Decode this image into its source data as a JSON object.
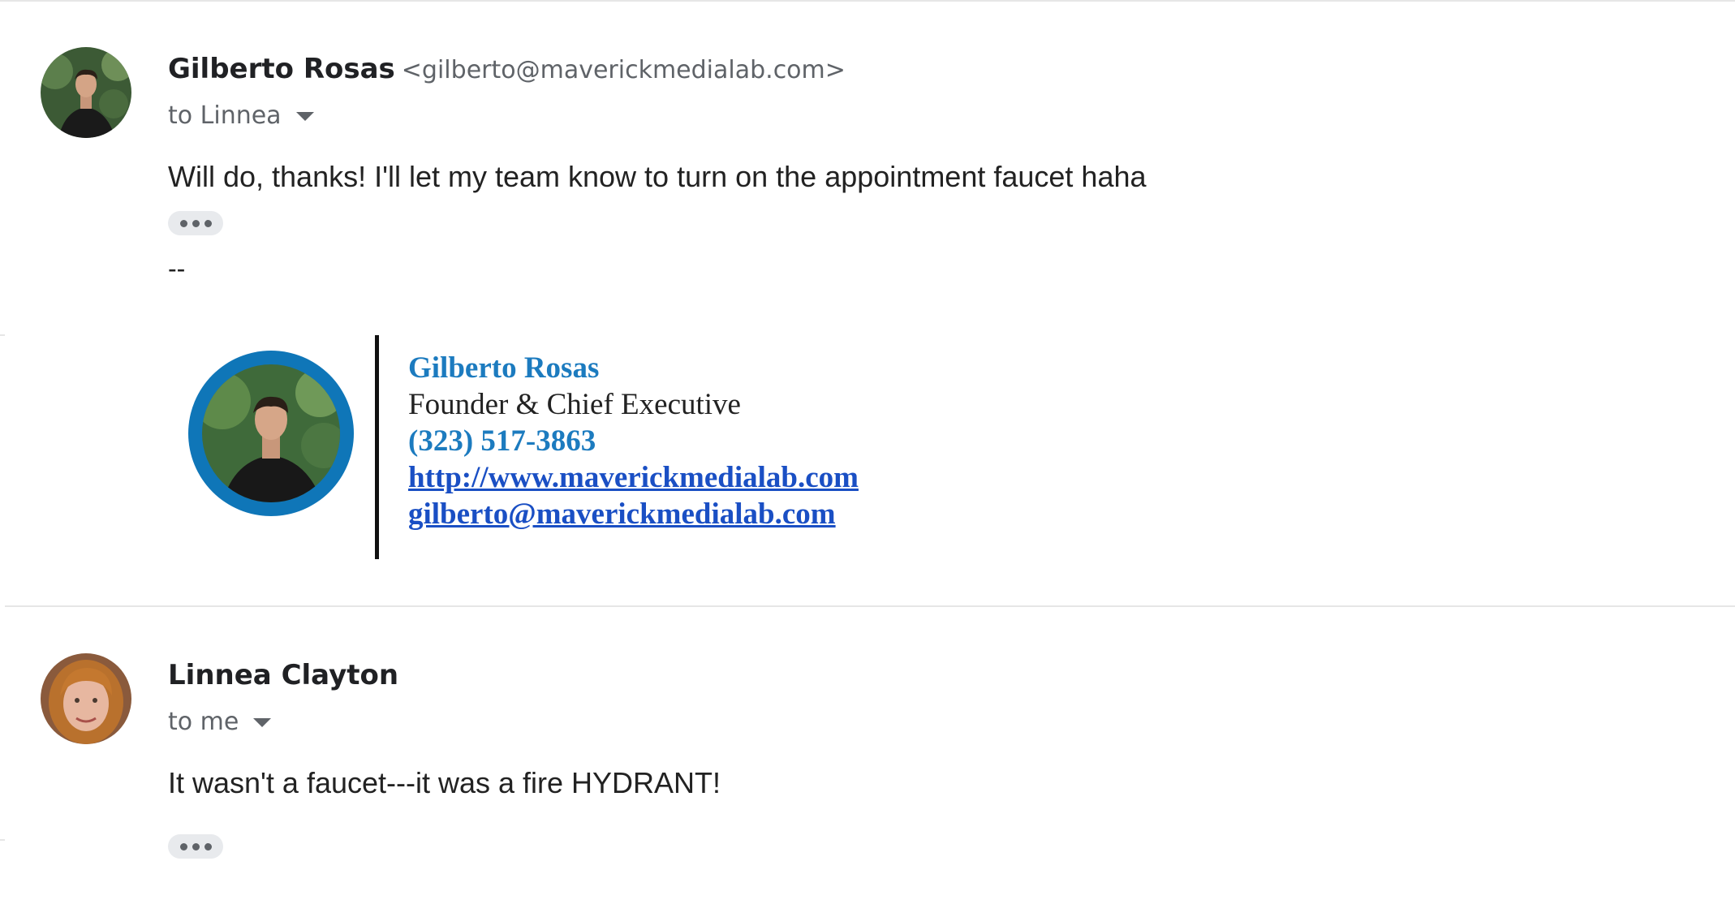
{
  "messages": [
    {
      "sender_name": "Gilberto Rosas",
      "sender_email": "<gilberto@maverickmedialab.com>",
      "recipient": "to Linnea",
      "body": "Will do, thanks! I'll let my team know to turn on the appointment faucet haha",
      "signature_separator": "--",
      "signature": {
        "name": "Gilberto Rosas",
        "title": "Founder & Chief Executive",
        "phone": "(323) 517-3863",
        "website": "http://www.maverickmedialab.com",
        "email": "gilberto@maverickmedialab.com"
      }
    },
    {
      "sender_name": "Linnea Clayton",
      "recipient": "to me",
      "body": "It wasn't a faucet---it was a fire HYDRANT!"
    }
  ],
  "icons": {
    "recipient_toggle": "caret-down-icon",
    "show_trimmed": "more-horiz-icon"
  },
  "colors": {
    "signature_accent": "#1c7bbf",
    "signature_link": "#1a4fc4",
    "photo_ring": "#0f76b8"
  }
}
